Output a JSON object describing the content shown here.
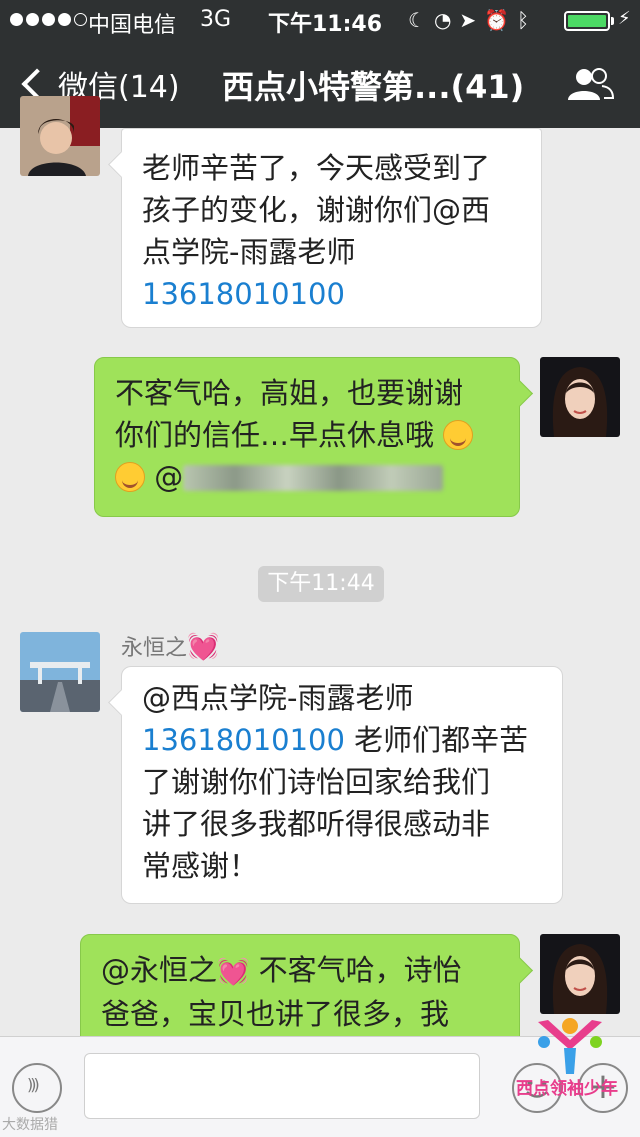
{
  "status_bar": {
    "carrier": "中国电信",
    "network": "3G",
    "time": "下午11:46",
    "icons": [
      "moon-icon",
      "lock-rotation-icon",
      "location-icon",
      "alarm-icon",
      "bluetooth-icon"
    ],
    "battery_level": 1.0,
    "battery_color": "#4cd964"
  },
  "nav": {
    "back_label": "微信(14)",
    "title": "西点小特警第...(41)",
    "bar_color": "#2e3132"
  },
  "messages": [
    {
      "side": "left",
      "lines": [
        "老师辛苦了，今天感受到了",
        "孩子的变化，谢谢你们@西",
        "点学院-雨露老师"
      ],
      "phone": "13618010100"
    },
    {
      "side": "right",
      "line1": "不客气哈，高姐，也要谢谢",
      "line2": "你们的信任…早点休息哦",
      "line3_prefix": "@"
    },
    {
      "timestamp": "下午11:44"
    },
    {
      "side": "left",
      "sender": "永恒之",
      "mention": "@西点学院-雨露老师",
      "phone": "13618010100",
      "after_phone": " 老师们都辛苦",
      "lines": [
        "了谢谢你们诗怡回家给我们",
        "讲了很多我都听得很感动非",
        "常感谢！"
      ]
    },
    {
      "side": "right",
      "mention": "@永恒之",
      "line1_rest": " 不客气哈，诗怡",
      "line2": "爸爸，宝贝也讲了很多，我"
    }
  ],
  "watermark": {
    "text": "西点领袖少年",
    "corner_text": "大数据猎"
  },
  "colors": {
    "right_bubble": "#9fe25a",
    "left_bubble": "#ffffff",
    "link": "#1a7fd0",
    "background": "#ebebeb"
  }
}
